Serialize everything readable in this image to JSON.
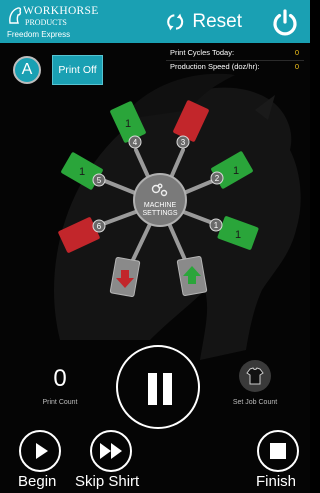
{
  "header": {
    "logo_line1": "WORKHORSE",
    "logo_line2": "PRODUCTS",
    "subtitle": "Freedom Express",
    "reset_label": "Reset"
  },
  "status": {
    "print_cycles_label": "Print Cycles Today:",
    "print_cycles_value": "0",
    "production_speed_label": "Production Speed (doz/hr):",
    "production_speed_value": "0"
  },
  "controls": {
    "mode_label": "A",
    "print_off_label": "Print Off"
  },
  "carousel": {
    "hub_line1": "MACHINE",
    "hub_line2": "SETTINGS",
    "stations": [
      {
        "number": "1",
        "count": "1",
        "state": "on"
      },
      {
        "number": "2",
        "count": "1",
        "state": "on"
      },
      {
        "number": "3",
        "count": "",
        "state": "off"
      },
      {
        "number": "4",
        "count": "1",
        "state": "on"
      },
      {
        "number": "5",
        "count": "1",
        "state": "on"
      },
      {
        "number": "6",
        "count": "",
        "state": "off"
      }
    ],
    "unload_station": "unload",
    "load_station": "load"
  },
  "bottom": {
    "print_count_value": "0",
    "print_count_label": "Print Count",
    "set_job_count_label": "Set Job Count",
    "begin_label": "Begin",
    "skip_shirt_label": "Skip Shirt",
    "finish_label": "Finish"
  },
  "colors": {
    "accent": "#1aa0b3",
    "station_on": "#2aa53a",
    "station_off": "#c2262b",
    "value": "#f3c31b"
  },
  "icons": {
    "reset": "reset-cycle-icon",
    "power": "power-icon",
    "pause": "pause-icon",
    "set_job": "shirt-icon",
    "begin": "play-icon",
    "skip": "fast-forward-icon",
    "finish": "stop-icon",
    "hub": "gears-icon"
  }
}
